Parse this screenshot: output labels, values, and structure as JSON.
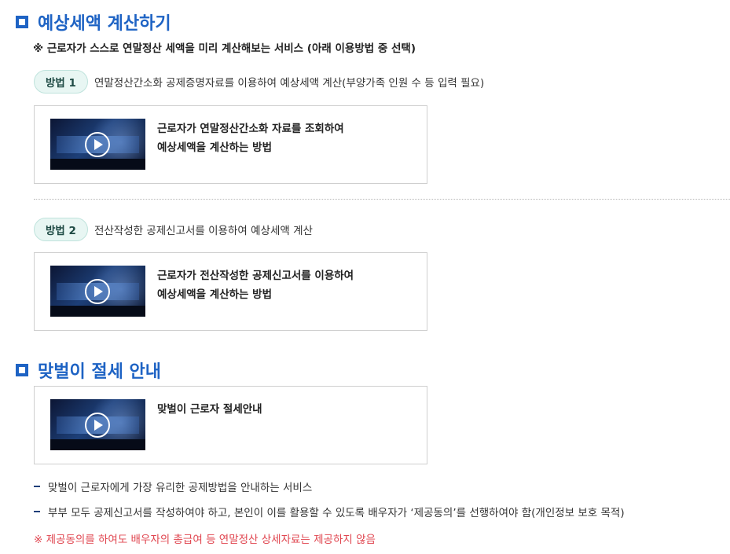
{
  "section1": {
    "title": "예상세액 계산하기",
    "note": "※ 근로자가 스스로 연말정산 세액을 미리 계산해보는 서비스 (아래 이용방법 중 선택)"
  },
  "method1": {
    "badge": "방법 1",
    "desc": "연말정산간소화 공제증명자료를 이용하여 예상세액 계산(부양가족 인원 수 등 입력 필요)",
    "video_line1": "근로자가 연말정산간소화 자료를 조회하여",
    "video_line2": "예상세액을 계산하는 방법"
  },
  "method2": {
    "badge": "방법 2",
    "desc": "전산작성한 공제신고서를 이용하여 예상세액 계산",
    "video_line1": "근로자가 전산작성한 공제신고서를 이용하여",
    "video_line2": "예상세액을 계산하는 방법"
  },
  "section2": {
    "title": "맞벌이 절세 안내",
    "video_line1": "맞벌이 근로자 절세안내",
    "bullets": [
      "맞벌이 근로자에게 가장 유리한 공제방법을 안내하는 서비스",
      "부부 모두 공제신고서를 작성하여야 하고, 본인이 이를 활용할 수 있도록 배우자가 ‘제공동의’를 선행하여야 함(개인정보 보호 목적)"
    ],
    "warning": "※ 제공동의를 하여도 배우자의 총급여 등 연말정산 상세자료는 제공하지 않음"
  },
  "icons": {
    "section": "square-bullet-icon",
    "play": "play-icon",
    "bullet": "dash-bullet-icon"
  },
  "colors": {
    "accent": "#1e63c4",
    "pill_bg": "#e8f6f3",
    "warning": "#e0454f"
  }
}
